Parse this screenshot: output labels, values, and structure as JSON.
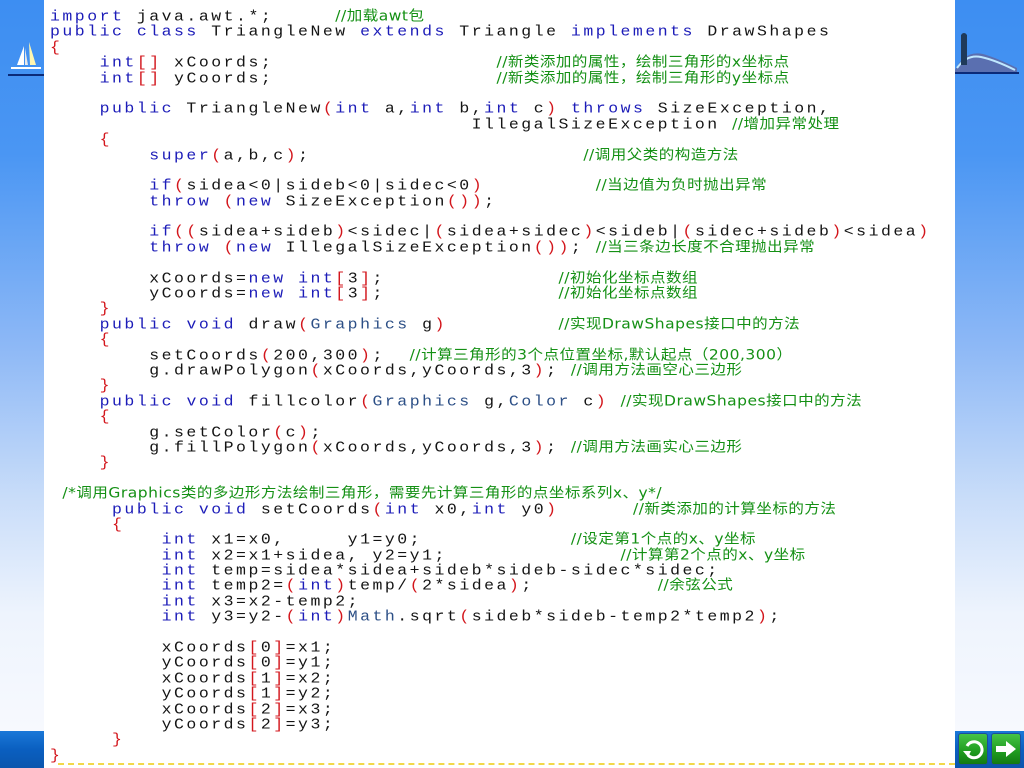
{
  "slide": {
    "nav": {
      "replay_icon": "replay-icon",
      "next_icon": "arrow-right-icon"
    },
    "decor": {
      "left_logo": "sailboat-icon",
      "right_logo": "island-wave-icon"
    },
    "colors": {
      "keyword": "#1c1cb8",
      "type": "#2c4f86",
      "punctuation": "#d3161c",
      "comment": "#149014",
      "text": "#141414",
      "side_blue": "#3d8ef2",
      "button_green": "#1f9a1f"
    }
  },
  "code": {
    "language": "java",
    "lines": [
      [
        [
          "k",
          "import"
        ],
        [
          "n",
          " java.awt.*;     "
        ],
        [
          "c",
          "//加载awt包"
        ]
      ],
      [
        [
          "k",
          "public"
        ],
        [
          "n",
          " "
        ],
        [
          "k",
          "class"
        ],
        [
          "n",
          " TriangleNew "
        ],
        [
          "k",
          "extends"
        ],
        [
          "n",
          " Triangle "
        ],
        [
          "k",
          "implements"
        ],
        [
          "n",
          " DrawShapes"
        ]
      ],
      [
        [
          "p",
          "{"
        ]
      ],
      [
        [
          "n",
          "    "
        ],
        [
          "k",
          "int"
        ],
        [
          "p",
          "[]"
        ],
        [
          "n",
          " xCoords;                  "
        ],
        [
          "c",
          "//新类添加的属性，绘制三角形的x坐标点"
        ]
      ],
      [
        [
          "n",
          "    "
        ],
        [
          "k",
          "int"
        ],
        [
          "p",
          "[]"
        ],
        [
          "n",
          " yCoords;                  "
        ],
        [
          "c",
          "//新类添加的属性，绘制三角形的y坐标点"
        ]
      ],
      [],
      [
        [
          "n",
          "    "
        ],
        [
          "k",
          "public"
        ],
        [
          "n",
          " TriangleNew"
        ],
        [
          "p",
          "("
        ],
        [
          "k",
          "int"
        ],
        [
          "n",
          " a,"
        ],
        [
          "k",
          "int"
        ],
        [
          "n",
          " b,"
        ],
        [
          "k",
          "int"
        ],
        [
          "n",
          " c"
        ],
        [
          "p",
          ")"
        ],
        [
          "n",
          " "
        ],
        [
          "k",
          "throws"
        ],
        [
          "n",
          " SizeException,"
        ]
      ],
      [
        [
          "n",
          "                                  IllegalSizeException "
        ],
        [
          "c",
          "//增加异常处理"
        ]
      ],
      [
        [
          "n",
          "    "
        ],
        [
          "p",
          "{"
        ]
      ],
      [
        [
          "n",
          "        "
        ],
        [
          "k",
          "super"
        ],
        [
          "p",
          "("
        ],
        [
          "n",
          "a,b,c"
        ],
        [
          "p",
          ")"
        ],
        [
          "n",
          ";                      "
        ],
        [
          "c",
          "//调用父类的构造方法"
        ]
      ],
      [],
      [
        [
          "n",
          "        "
        ],
        [
          "k",
          "if"
        ],
        [
          "p",
          "("
        ],
        [
          "n",
          "sidea<0|sideb<0|sidec<0"
        ],
        [
          "p",
          ")"
        ],
        [
          "n",
          "         "
        ],
        [
          "c",
          "//当边值为负时抛出异常"
        ]
      ],
      [
        [
          "n",
          "        "
        ],
        [
          "k",
          "throw"
        ],
        [
          "n",
          " "
        ],
        [
          "p",
          "("
        ],
        [
          "k",
          "new"
        ],
        [
          "n",
          " SizeException"
        ],
        [
          "p",
          "())"
        ],
        [
          "n",
          ";"
        ]
      ],
      [],
      [
        [
          "n",
          "        "
        ],
        [
          "k",
          "if"
        ],
        [
          "p",
          "(("
        ],
        [
          "n",
          "sidea+sideb"
        ],
        [
          "p",
          ")"
        ],
        [
          "n",
          "<sidec|"
        ],
        [
          "p",
          "("
        ],
        [
          "n",
          "sidea+sidec"
        ],
        [
          "p",
          ")"
        ],
        [
          "n",
          "<sideb|"
        ],
        [
          "p",
          "("
        ],
        [
          "n",
          "sidec+sideb"
        ],
        [
          "p",
          ")"
        ],
        [
          "n",
          "<sidea"
        ],
        [
          "p",
          ")"
        ]
      ],
      [
        [
          "n",
          "        "
        ],
        [
          "k",
          "throw"
        ],
        [
          "n",
          " "
        ],
        [
          "p",
          "("
        ],
        [
          "k",
          "new"
        ],
        [
          "n",
          " IllegalSizeException"
        ],
        [
          "p",
          "())"
        ],
        [
          "n",
          "; "
        ],
        [
          "c",
          "//当三条边长度不合理抛出异常"
        ]
      ],
      [],
      [
        [
          "n",
          "        xCoords="
        ],
        [
          "k",
          "new"
        ],
        [
          "n",
          " "
        ],
        [
          "k",
          "int"
        ],
        [
          "p",
          "["
        ],
        [
          "n",
          "3"
        ],
        [
          "p",
          "]"
        ],
        [
          "n",
          ";              "
        ],
        [
          "c",
          "//初始化坐标点数组"
        ]
      ],
      [
        [
          "n",
          "        yCoords="
        ],
        [
          "k",
          "new"
        ],
        [
          "n",
          " "
        ],
        [
          "k",
          "int"
        ],
        [
          "p",
          "["
        ],
        [
          "n",
          "3"
        ],
        [
          "p",
          "]"
        ],
        [
          "n",
          ";              "
        ],
        [
          "c",
          "//初始化坐标点数组"
        ]
      ],
      [
        [
          "n",
          "    "
        ],
        [
          "p",
          "}"
        ]
      ],
      [
        [
          "n",
          "    "
        ],
        [
          "k",
          "public"
        ],
        [
          "n",
          " "
        ],
        [
          "k",
          "void"
        ],
        [
          "n",
          " draw"
        ],
        [
          "p",
          "("
        ],
        [
          "t",
          "Graphics"
        ],
        [
          "n",
          " g"
        ],
        [
          "p",
          ")"
        ],
        [
          "n",
          "         "
        ],
        [
          "c",
          "//实现DrawShapes接口中的方法"
        ]
      ],
      [
        [
          "n",
          "    "
        ],
        [
          "p",
          "{"
        ]
      ],
      [
        [
          "n",
          "        setCoords"
        ],
        [
          "p",
          "("
        ],
        [
          "n",
          "200,300"
        ],
        [
          "p",
          ")"
        ],
        [
          "n",
          ";  "
        ],
        [
          "c",
          "//计算三角形的3个点位置坐标,默认起点（200,300）"
        ]
      ],
      [
        [
          "n",
          "        g.drawPolygon"
        ],
        [
          "p",
          "("
        ],
        [
          "n",
          "xCoords,yCoords,3"
        ],
        [
          "p",
          ")"
        ],
        [
          "n",
          "; "
        ],
        [
          "c",
          "//调用方法画空心三边形"
        ]
      ],
      [
        [
          "n",
          "    "
        ],
        [
          "p",
          "}"
        ]
      ],
      [
        [
          "n",
          "    "
        ],
        [
          "k",
          "public"
        ],
        [
          "n",
          " "
        ],
        [
          "k",
          "void"
        ],
        [
          "n",
          " fillcolor"
        ],
        [
          "p",
          "("
        ],
        [
          "t",
          "Graphics"
        ],
        [
          "n",
          " g,"
        ],
        [
          "t",
          "Color"
        ],
        [
          "n",
          " c"
        ],
        [
          "p",
          ")"
        ],
        [
          "n",
          " "
        ],
        [
          "c",
          "//实现DrawShapes接口中的方法"
        ]
      ],
      [
        [
          "n",
          "    "
        ],
        [
          "p",
          "{"
        ]
      ],
      [
        [
          "n",
          "        g.setColor"
        ],
        [
          "p",
          "("
        ],
        [
          "n",
          "c"
        ],
        [
          "p",
          ")"
        ],
        [
          "n",
          ";"
        ]
      ],
      [
        [
          "n",
          "        g.fillPolygon"
        ],
        [
          "p",
          "("
        ],
        [
          "n",
          "xCoords,yCoords,3"
        ],
        [
          "p",
          ")"
        ],
        [
          "n",
          "; "
        ],
        [
          "c",
          "//调用方法画实心三边形"
        ]
      ],
      [
        [
          "n",
          "    "
        ],
        [
          "p",
          "}"
        ]
      ],
      [],
      [
        [
          "n",
          " "
        ],
        [
          "c",
          "/*调用Graphics类的多边形方法绘制三角形，需要先计算三角形的点坐标系列x、y*/"
        ]
      ],
      [
        [
          "n",
          "     "
        ],
        [
          "k",
          "public"
        ],
        [
          "n",
          " "
        ],
        [
          "k",
          "void"
        ],
        [
          "n",
          " setCoords"
        ],
        [
          "p",
          "("
        ],
        [
          "k",
          "int"
        ],
        [
          "n",
          " x0,"
        ],
        [
          "k",
          "int"
        ],
        [
          "n",
          " y0"
        ],
        [
          "p",
          ")"
        ],
        [
          "n",
          "      "
        ],
        [
          "c",
          "//新类添加的计算坐标的方法"
        ]
      ],
      [
        [
          "n",
          "     "
        ],
        [
          "p",
          "{"
        ]
      ],
      [
        [
          "n",
          "         "
        ],
        [
          "k",
          "int"
        ],
        [
          "n",
          " x1=x0,     y1=y0;            "
        ],
        [
          "c",
          "//设定第1个点的x、y坐标"
        ]
      ],
      [
        [
          "n",
          "         "
        ],
        [
          "k",
          "int"
        ],
        [
          "n",
          " x2=x1+sidea, y2=y1;              "
        ],
        [
          "c",
          "//计算第2个点的x、y坐标"
        ]
      ],
      [
        [
          "n",
          "         "
        ],
        [
          "k",
          "int"
        ],
        [
          "n",
          " temp=sidea*sidea+sideb*sideb-sidec*sidec;"
        ]
      ],
      [
        [
          "n",
          "         "
        ],
        [
          "k",
          "int"
        ],
        [
          "n",
          " temp2="
        ],
        [
          "p",
          "("
        ],
        [
          "k",
          "int"
        ],
        [
          "p",
          ")"
        ],
        [
          "n",
          "temp/"
        ],
        [
          "p",
          "("
        ],
        [
          "n",
          "2*sidea"
        ],
        [
          "p",
          ")"
        ],
        [
          "n",
          ";          "
        ],
        [
          "c",
          "//余弦公式"
        ]
      ],
      [
        [
          "n",
          "         "
        ],
        [
          "k",
          "int"
        ],
        [
          "n",
          " x3=x2-temp2;"
        ]
      ],
      [
        [
          "n",
          "         "
        ],
        [
          "k",
          "int"
        ],
        [
          "n",
          " y3=y2-"
        ],
        [
          "p",
          "("
        ],
        [
          "k",
          "int"
        ],
        [
          "p",
          ")"
        ],
        [
          "t",
          "Math"
        ],
        [
          "n",
          ".sqrt"
        ],
        [
          "p",
          "("
        ],
        [
          "n",
          "sideb*sideb-temp2*temp2"
        ],
        [
          "p",
          ")"
        ],
        [
          "n",
          ";"
        ]
      ],
      [],
      [
        [
          "n",
          "         xCoords"
        ],
        [
          "p",
          "["
        ],
        [
          "n",
          "0"
        ],
        [
          "p",
          "]"
        ],
        [
          "n",
          "=x1;"
        ]
      ],
      [
        [
          "n",
          "         yCoords"
        ],
        [
          "p",
          "["
        ],
        [
          "n",
          "0"
        ],
        [
          "p",
          "]"
        ],
        [
          "n",
          "=y1;"
        ]
      ],
      [
        [
          "n",
          "         xCoords"
        ],
        [
          "p",
          "["
        ],
        [
          "n",
          "1"
        ],
        [
          "p",
          "]"
        ],
        [
          "n",
          "=x2;"
        ]
      ],
      [
        [
          "n",
          "         yCoords"
        ],
        [
          "p",
          "["
        ],
        [
          "n",
          "1"
        ],
        [
          "p",
          "]"
        ],
        [
          "n",
          "=y2;"
        ]
      ],
      [
        [
          "n",
          "         xCoords"
        ],
        [
          "p",
          "["
        ],
        [
          "n",
          "2"
        ],
        [
          "p",
          "]"
        ],
        [
          "n",
          "=x3;"
        ]
      ],
      [
        [
          "n",
          "         yCoords"
        ],
        [
          "p",
          "["
        ],
        [
          "n",
          "2"
        ],
        [
          "p",
          "]"
        ],
        [
          "n",
          "=y3;"
        ]
      ],
      [
        [
          "n",
          "     "
        ],
        [
          "p",
          "}"
        ]
      ],
      [
        [
          "p",
          "}"
        ]
      ]
    ]
  }
}
